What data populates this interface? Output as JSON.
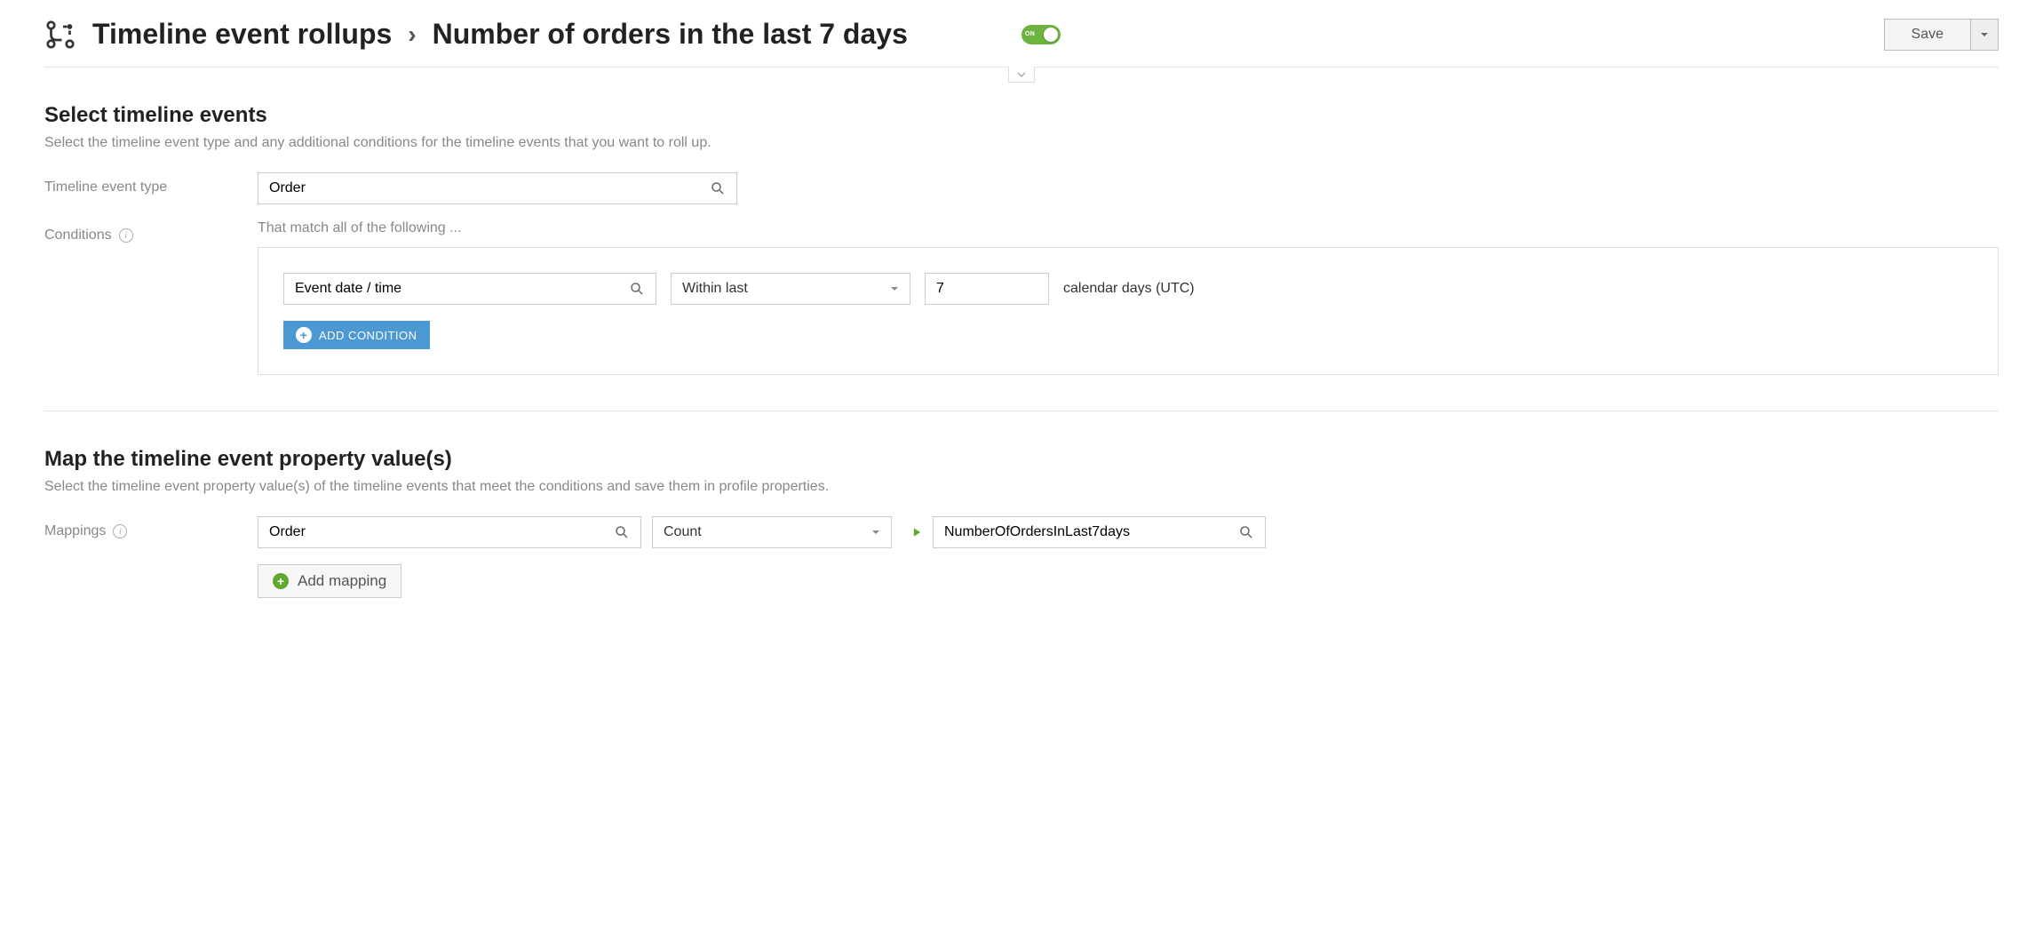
{
  "header": {
    "breadcrumb_parent": "Timeline event rollups",
    "breadcrumb_separator": "›",
    "page_title": "Number of orders in the last 7 days",
    "toggle_label": "ON",
    "save_label": "Save"
  },
  "section_select": {
    "title": "Select timeline events",
    "desc": "Select the timeline event type and any additional conditions for the timeline events that you want to roll up.",
    "event_type_label": "Timeline event type",
    "event_type_value": "Order",
    "conditions_label": "Conditions",
    "conditions_hint": "That match all of the following ...",
    "cond_field": "Event date / time",
    "cond_op": "Within last",
    "cond_value": "7",
    "cond_unit": "calendar days (UTC)",
    "add_condition": "ADD CONDITION"
  },
  "section_map": {
    "title": "Map the timeline event property value(s)",
    "desc": "Select the timeline event property value(s) of the timeline events that meet the conditions and save them in profile properties.",
    "mappings_label": "Mappings",
    "source_value": "Order",
    "agg_value": "Count",
    "target_value": "NumberOfOrdersInLast7days",
    "add_mapping": "Add mapping"
  }
}
